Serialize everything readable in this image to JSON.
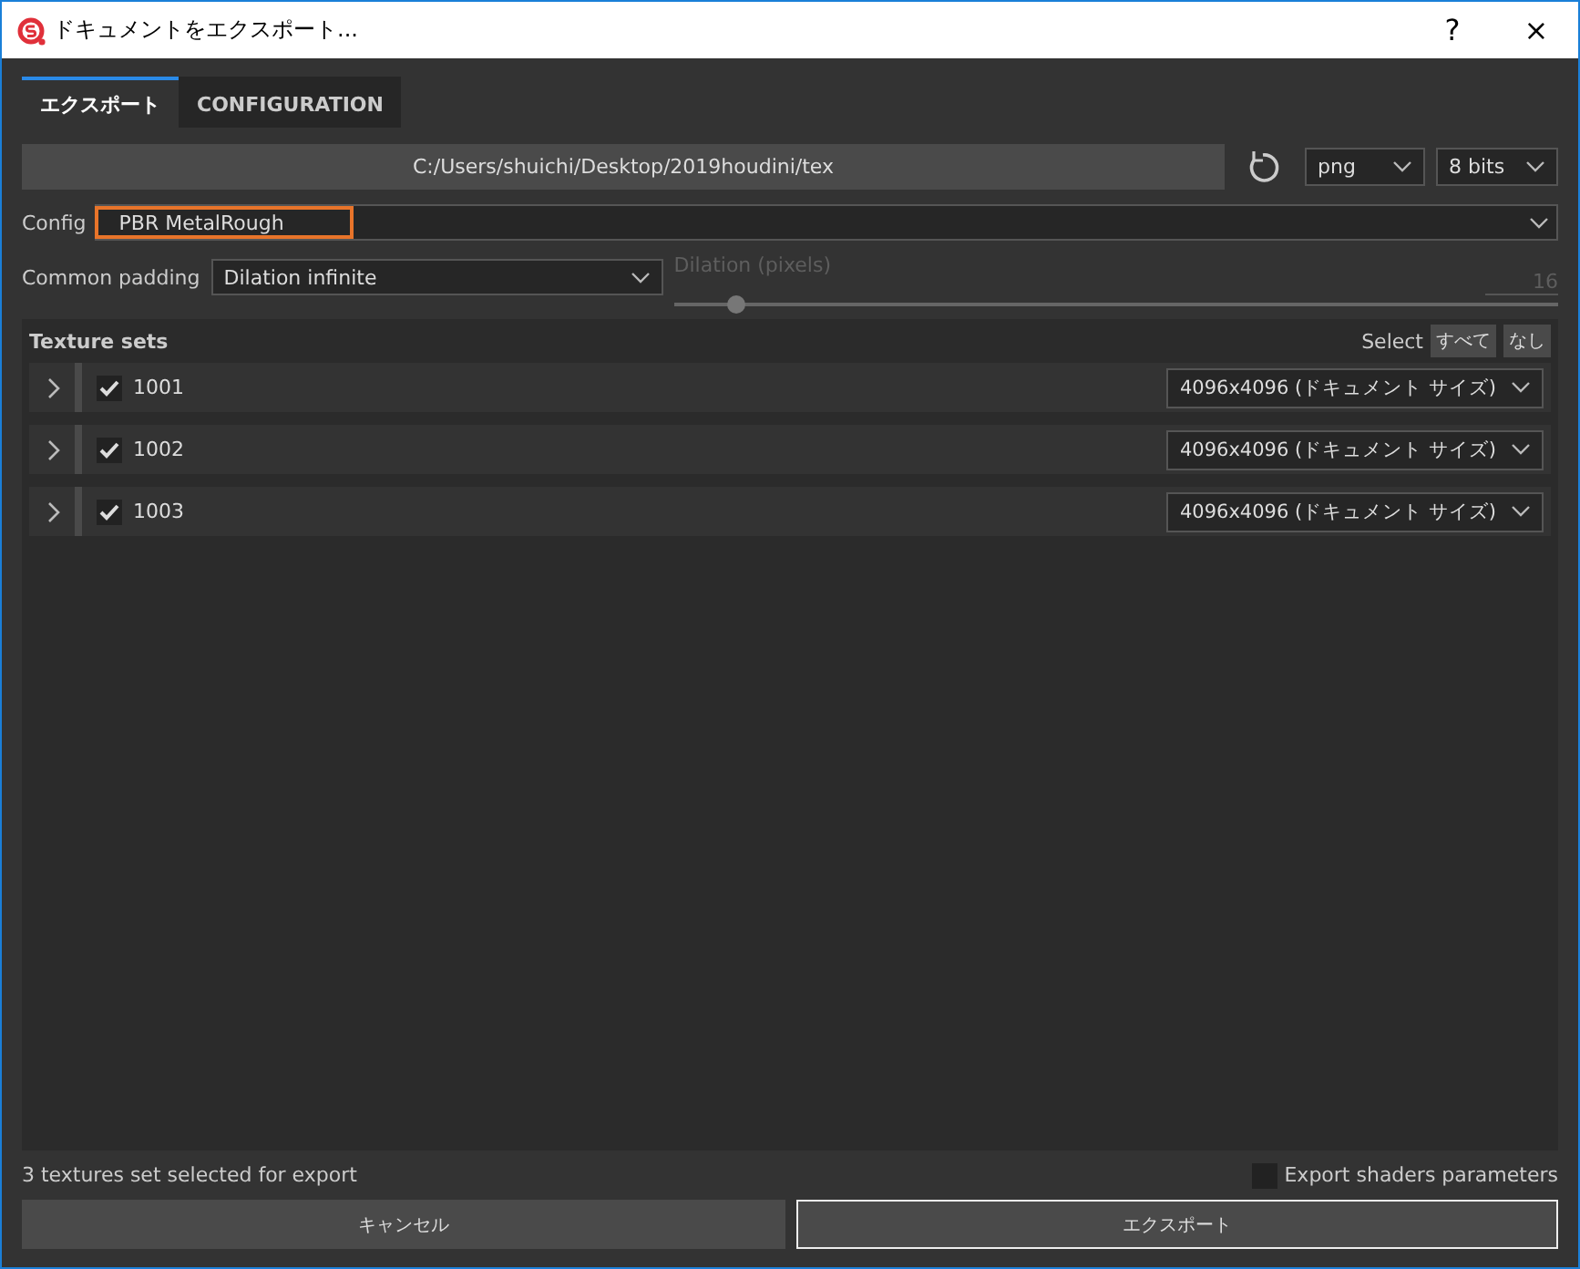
{
  "window": {
    "title": "ドキュメントをエクスポート...",
    "help": "?",
    "close": "×"
  },
  "tabs": [
    {
      "label": "エクスポート",
      "selected": true
    },
    {
      "label": "CONFIGURATION",
      "selected": false
    }
  ],
  "output": {
    "path": "C:/Users/shuichi/Desktop/2019houdini/tex",
    "format": "png",
    "bit_depth": "8 bits"
  },
  "config": {
    "label": "Config",
    "value": "PBR MetalRough"
  },
  "padding": {
    "label": "Common padding",
    "value": "Dilation infinite",
    "dilation_label": "Dilation (pixels)",
    "dilation_value": "16",
    "level": 0.07,
    "disabled": true
  },
  "texture_sets": {
    "title": "Texture sets",
    "select_label": "Select",
    "select_all": "すべて",
    "select_none": "なし",
    "rows": [
      {
        "name": "1001",
        "checked": true,
        "expanded": false,
        "size": "4096x4096 (ドキュメント サイズ)"
      },
      {
        "name": "1002",
        "checked": true,
        "expanded": false,
        "size": "4096x4096 (ドキュメント サイズ)"
      },
      {
        "name": "1003",
        "checked": true,
        "expanded": false,
        "size": "4096x4096 (ドキュメント サイズ)"
      }
    ]
  },
  "status": "3 textures set selected for export",
  "export_shaders": {
    "label": "Export shaders parameters",
    "checked": false
  },
  "buttons": [
    {
      "label": "キャンセル",
      "primary": false
    },
    {
      "label": "エクスポート",
      "primary": true
    }
  ]
}
